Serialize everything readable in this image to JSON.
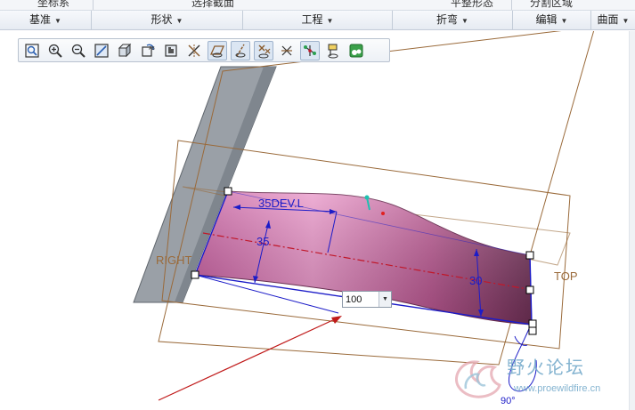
{
  "ribbon_top": {
    "fragments": [
      "坐标系",
      "选择截面",
      "平整形态",
      "分割区域"
    ]
  },
  "groups": [
    {
      "label": "基准"
    },
    {
      "label": "形状"
    },
    {
      "label": "工程"
    },
    {
      "label": "折弯"
    },
    {
      "label": "编辑"
    },
    {
      "label": "曲面"
    }
  ],
  "view_toolbar": {
    "buttons": [
      {
        "name": "refit-icon",
        "glyph": "⛶"
      },
      {
        "name": "zoom-in-icon",
        "glyph": "+"
      },
      {
        "name": "zoom-out-icon",
        "glyph": "−"
      },
      {
        "name": "repaint-icon",
        "glyph": "▢"
      },
      {
        "name": "display-style-icon",
        "glyph": "◧"
      },
      {
        "name": "saved-orientations-icon",
        "glyph": "↻"
      },
      {
        "name": "view-manager-icon",
        "glyph": "▣"
      },
      {
        "name": "datum-display-filters-icon",
        "glyph": "✕"
      },
      {
        "name": "plane-display-icon",
        "glyph": "▱"
      },
      {
        "name": "axis-display-icon",
        "glyph": "/"
      },
      {
        "name": "point-display-icon",
        "glyph": "×"
      },
      {
        "name": "csys-display-icon",
        "glyph": "⌗"
      },
      {
        "name": "spin-center-icon",
        "glyph": "⊹"
      },
      {
        "name": "annotation-display-icon",
        "glyph": "⚑"
      },
      {
        "name": "appearance-icon",
        "glyph": "◉"
      }
    ]
  },
  "viewport": {
    "plane_labels": {
      "right": "RIGHT",
      "top": "TOP"
    },
    "dimensions": {
      "dev_length": "35DEV.L",
      "height_left": "35",
      "height_right": "30",
      "angle": "90°"
    },
    "dim_input": {
      "value": "100"
    }
  },
  "watermark": {
    "name_cn": "野火论坛",
    "url": "www.proewildfire.cn"
  },
  "colors": {
    "surface_light": "#e58ec4",
    "surface_dark": "#6e2f55",
    "plane_brown": "#9a6a3a",
    "wall_gray": "#9aa0a7",
    "sketch_blue": "#1c1cc8",
    "centerline_red": "#c0182a",
    "watermark_blue": "#6ea6c8"
  }
}
